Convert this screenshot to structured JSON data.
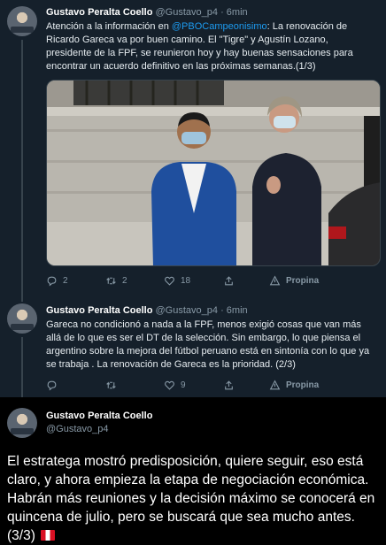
{
  "tweets": [
    {
      "author": "Gustavo Peralta Coello",
      "handle": "@Gustavo_p4",
      "dot": "·",
      "time": "6min",
      "text_pre": "Atención a la información en ",
      "mention": "@PBOCampeonisimo",
      "text_post": ": La renovación de Ricardo Gareca va por buen camino. El \"Tigre\" y Agustín Lozano, presidente de la FPF, se reunieron hoy y hay buenas sensaciones para encontrar un acuerdo definitivo en las próximas semanas.(1/3)",
      "replies": "2",
      "retweets": "2",
      "likes": "18",
      "promote": "Propina"
    },
    {
      "author": "Gustavo Peralta Coello",
      "handle": "@Gustavo_p4",
      "dot": "·",
      "time": "6min",
      "text": "Gareca no condicionó a nada a la FPF, menos exigió cosas que van más allá de lo que es ser el DT de la selección. Sin embargo, lo que piensa el argentino sobre la mejora del fútbol peruano está en sintonía con lo que ya se trabaja . La renovación de Gareca es la prioridad. (2/3)",
      "replies": "",
      "retweets": "",
      "likes": "9",
      "promote": "Propina"
    },
    {
      "author": "Gustavo Peralta Coello",
      "handle": "@Gustavo_p4",
      "text": "El estratega mostró predisposición, quiere seguir, eso está claro, y ahora empieza la etapa de negociación económica. Habrán más reuniones y la decisión máximo se conocerá en quincena de julio, pero se buscará que sea mucho antes. (3/3)"
    }
  ],
  "colors": {
    "background": "#15202b",
    "detail_background": "#000000",
    "link": "#1d9bf0",
    "muted": "#8899a6"
  }
}
